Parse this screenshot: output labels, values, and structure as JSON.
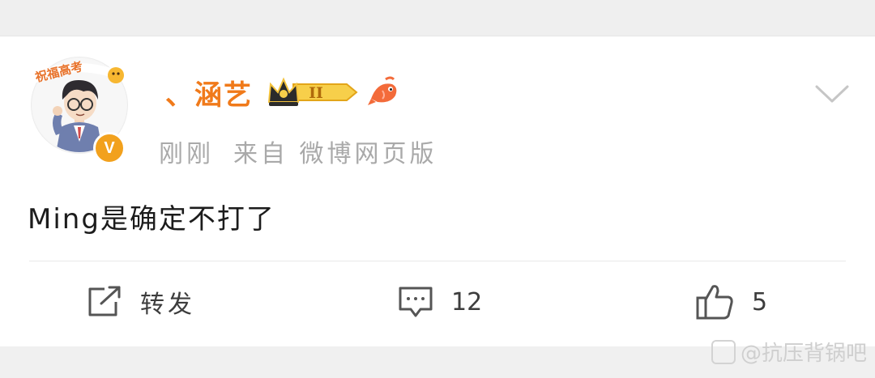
{
  "post": {
    "username": "、涵艺",
    "level_badge": "II",
    "timestamp": "刚刚",
    "source": "来自 微博网页版",
    "text": "Ming是确定不打了",
    "avatar_tag": "祝福高考"
  },
  "actions": {
    "repost_label": "转发",
    "comment_count": "12",
    "like_count": "5"
  },
  "watermark": {
    "text": "@抗压背锅吧"
  },
  "icons": {
    "verified": "verified-v-icon",
    "crown": "crown-badge-icon",
    "fish": "fish-icon",
    "expand": "chevron-down-icon",
    "repost": "repost-icon",
    "comment": "comment-icon",
    "like": "thumbs-up-icon"
  },
  "colors": {
    "username": "#f07a1a",
    "verified": "#f2a11d",
    "meta": "#a9a9a9"
  }
}
